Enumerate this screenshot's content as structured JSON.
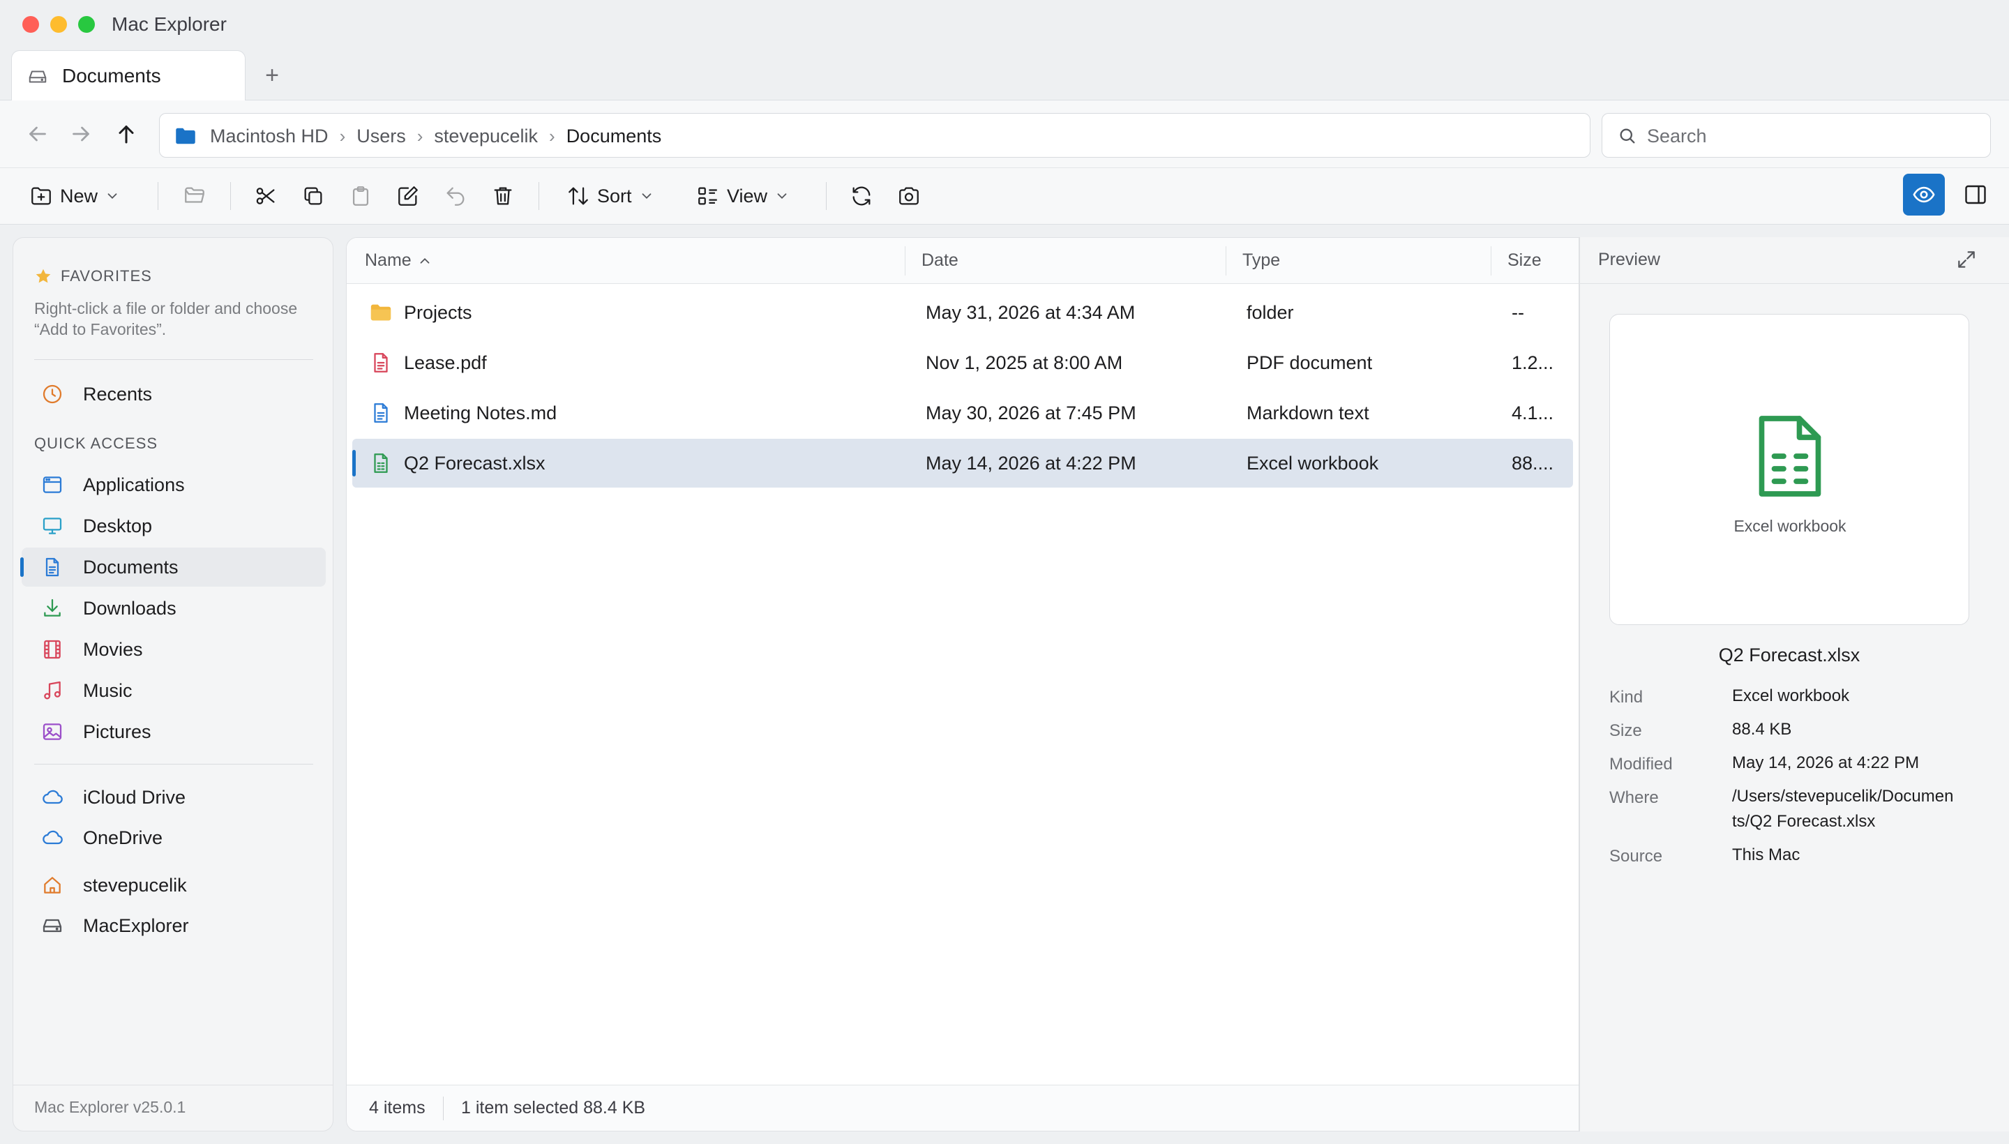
{
  "window": {
    "title": "Mac Explorer"
  },
  "tabs": [
    {
      "label": "Documents"
    }
  ],
  "breadcrumb": [
    "Macintosh HD",
    "Users",
    "stevepucelik",
    "Documents"
  ],
  "search": {
    "placeholder": "Search",
    "value": ""
  },
  "toolbar": {
    "new_label": "New",
    "sort_label": "Sort",
    "view_label": "View"
  },
  "sidebar": {
    "favorites_heading": "FAVORITES",
    "favorites_hint": "Right-click a file or folder and choose “Add to Favorites”.",
    "recents": {
      "label": "Recents",
      "icon": "clock-icon",
      "color": "#e07b2c"
    },
    "quick_access_heading": "QUICK ACCESS",
    "quick_access": [
      {
        "label": "Applications",
        "icon": "applications-icon",
        "color": "#2b7bd6"
      },
      {
        "label": "Desktop",
        "icon": "desktop-icon",
        "color": "#2aa0c8"
      },
      {
        "label": "Documents",
        "icon": "document-icon",
        "color": "#2b7bd6",
        "active": true
      },
      {
        "label": "Downloads",
        "icon": "download-icon",
        "color": "#2e9a52"
      },
      {
        "label": "Movies",
        "icon": "film-icon",
        "color": "#d8455a"
      },
      {
        "label": "Music",
        "icon": "music-icon",
        "color": "#d8455a"
      },
      {
        "label": "Pictures",
        "icon": "pictures-icon",
        "color": "#9b4fc9"
      }
    ],
    "cloud": [
      {
        "label": "iCloud Drive",
        "icon": "cloud-icon",
        "color": "#2b7bd6"
      },
      {
        "label": "OneDrive",
        "icon": "cloud-icon",
        "color": "#2b7bd6"
      }
    ],
    "locations": [
      {
        "label": "stevepucelik",
        "icon": "home-icon",
        "color": "#e07b2c"
      },
      {
        "label": "MacExplorer",
        "icon": "drive-icon",
        "color": "#55575c"
      }
    ],
    "version": "Mac Explorer v25.0.1"
  },
  "file_list": {
    "columns": {
      "name": "Name",
      "date": "Date",
      "type": "Type",
      "size": "Size"
    },
    "sort": {
      "column": "Name",
      "direction": "ascending"
    },
    "rows": [
      {
        "name": "Projects",
        "date": "May 31, 2026 at 4:34 AM",
        "type": "folder",
        "size": "--",
        "icon": "folder-icon"
      },
      {
        "name": "Lease.pdf",
        "date": "Nov 1, 2025 at 8:00 AM",
        "type": "PDF document",
        "size": "1.2...",
        "icon": "pdf-icon"
      },
      {
        "name": "Meeting Notes.md",
        "date": "May 30, 2026 at 7:45 PM",
        "type": "Markdown text",
        "size": "4.1...",
        "icon": "text-file-icon"
      },
      {
        "name": "Q2 Forecast.xlsx",
        "date": "May 14, 2026 at 4:22 PM",
        "type": "Excel workbook",
        "size": "88....",
        "icon": "spreadsheet-icon",
        "selected": true
      }
    ],
    "status_count": "4 items",
    "status_selection": "1 item selected 88.4 KB"
  },
  "preview": {
    "heading": "Preview",
    "kind_caption": "Excel workbook",
    "file_name": "Q2 Forecast.xlsx",
    "meta": [
      {
        "key": "Kind",
        "value": "Excel workbook"
      },
      {
        "key": "Size",
        "value": "88.4 KB"
      },
      {
        "key": "Modified",
        "value": "May 14, 2026 at 4:22 PM"
      },
      {
        "key": "Where",
        "value": "/Users/stevepucelik/Documents/Q2 Forecast.xlsx"
      },
      {
        "key": "Source",
        "value": "This Mac"
      }
    ]
  },
  "colors": {
    "accent": "#1a73c7",
    "selection": "#dde4ee",
    "excel_green": "#2e9a52",
    "pdf_red": "#d8455a",
    "folder_yellow": "#f2b63c"
  }
}
